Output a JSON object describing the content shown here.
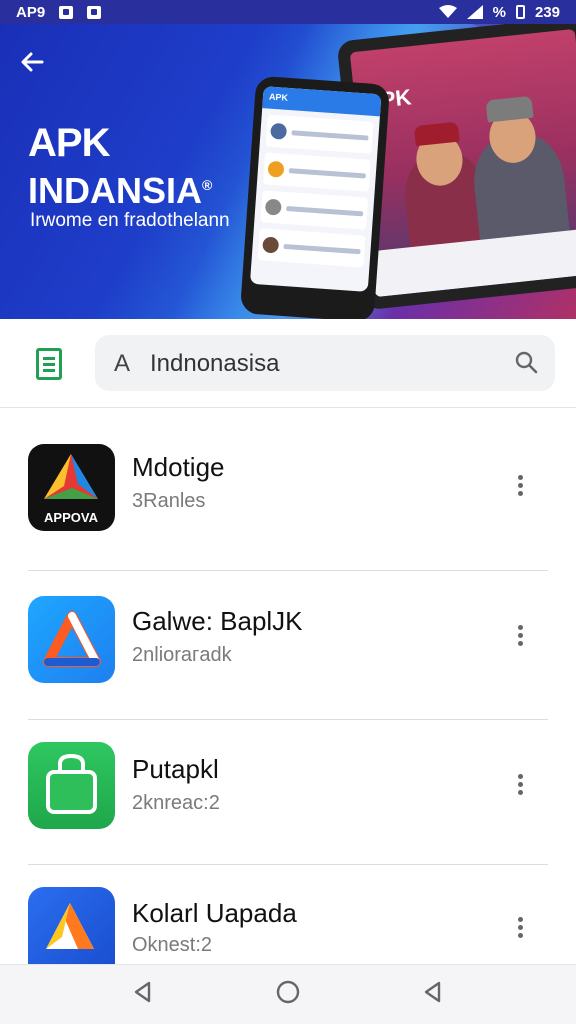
{
  "status_bar": {
    "left_text": "AP9",
    "right_text": "%",
    "time": "239"
  },
  "hero": {
    "title_line1": "APK",
    "title_line2": "INDANSIA",
    "registered_mark": "®",
    "subtitle": "Irwome en fradothelann",
    "phone_header": "APK",
    "tablet_logo": "APK"
  },
  "search": {
    "prefix": "A",
    "query": "Indnonasisa"
  },
  "apps": [
    {
      "name": "Mdotige",
      "subtitle": "3Ranles",
      "icon": "tri-color-app-icon",
      "icon_label": "APPOVA"
    },
    {
      "name": "Galwe: BaplJK",
      "subtitle": "2nliorагadk",
      "icon": "blue-triangle-app-icon"
    },
    {
      "name": "Putapkl",
      "subtitle": "2knreac:2",
      "icon": "green-bag-app-icon"
    },
    {
      "name": "Kolarl Uapada",
      "subtitle": "Oknest:2",
      "icon": "blue-prism-app-icon"
    }
  ],
  "colors": {
    "hero_blue": "#1e3ec9",
    "accent_green": "#20a050",
    "status_bar": "#2a2f9e"
  }
}
